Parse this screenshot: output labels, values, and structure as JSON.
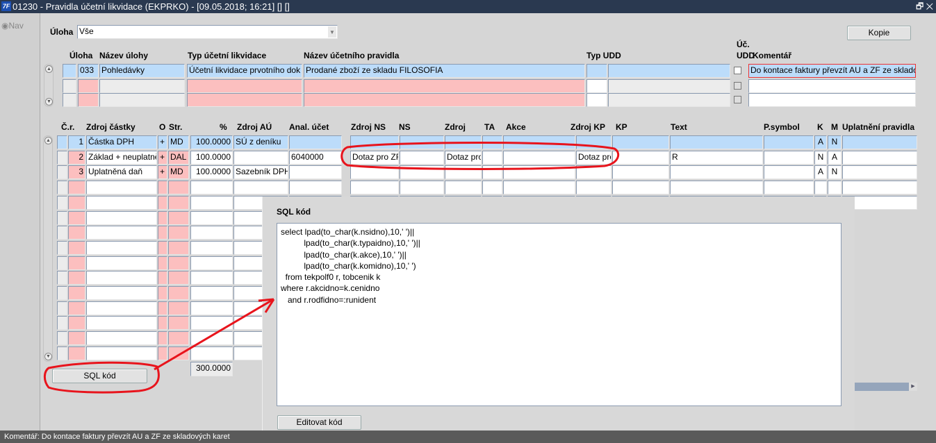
{
  "window": {
    "title": "01230 - Pravidla účetní likvidace (EKPRKO) - [09.05.2018; 16:21] [] []",
    "app_icon": "7F",
    "restore_icon": "🗗",
    "close_icon": "✕"
  },
  "nav": {
    "label": "Nav"
  },
  "filter": {
    "label": "Úloha",
    "value": "Vše"
  },
  "buttons": {
    "kopie": "Kopie",
    "sql": "SQL kód",
    "edit": "Editovat kód"
  },
  "top_grid": {
    "headers": [
      "Úloha",
      "Název úlohy",
      "Typ účetní likvidace",
      "Název účetního pravidla",
      "Typ UDD",
      "Úč.",
      "UDD",
      "Komentář"
    ],
    "rows": [
      {
        "uloha": "033",
        "nazev": "Pohledávky",
        "typ": "Účetní likvidace prvotního dok",
        "pravidlo": "Prodané zboží ze skladu FILOSOFIA",
        "komentar": "Do kontace faktury převzít AU a ZF ze skladových karet"
      },
      {
        "uloha": "",
        "nazev": "",
        "typ": "",
        "pravidlo": "",
        "komentar": ""
      },
      {
        "uloha": "",
        "nazev": "",
        "typ": "",
        "pravidlo": "",
        "komentar": ""
      }
    ]
  },
  "bottom_grid": {
    "headers": [
      "Č.r.",
      "Zdroj částky",
      "O",
      "Str.",
      "%",
      "Zdroj AÚ",
      "Anal. účet",
      "Zdroj NS",
      "NS",
      "Zdroj",
      "TA",
      "Akce",
      "Zdroj KP",
      "KP",
      "Text",
      "P.symbol",
      "K",
      "M",
      "Uplatnění pravidla"
    ],
    "rows": [
      [
        "1",
        "Částka DPH",
        "+",
        "MD",
        "100.0000",
        "SÚ z deníku",
        "",
        "",
        "",
        "",
        "",
        "",
        "",
        "",
        "",
        "",
        "A",
        "N",
        ""
      ],
      [
        "2",
        "Základ + neuplatněná daň",
        "+",
        "DAL",
        "100.0000",
        "",
        "6040000",
        "Dotaz pro ZF",
        "",
        "Dotaz pro",
        "",
        "",
        "Dotaz pro",
        "",
        "R",
        "",
        "N",
        "A",
        ""
      ],
      [
        "3",
        "Uplatněná daň",
        "+",
        "MD",
        "100.0000",
        "Sazebník DPH",
        "",
        "",
        "",
        "",
        "",
        "",
        "",
        "",
        "",
        "",
        "A",
        "N",
        ""
      ]
    ],
    "total_percent": "300.0000"
  },
  "sql_dialog": {
    "title": "SQL kód",
    "code": "select lpad(to_char(k.nsidno),10,' ')||\n          lpad(to_char(k.typaidno),10,' ')||\n          lpad(to_char(k.akce),10,' ')||\n          lpad(to_char(k.komidno),10,' ')\n  from tekpolf0 r, tobcenik k\nwhere r.akcidno=k.cenidno\n   and r.rodfidno=:runident"
  },
  "status": {
    "text": "Komentář: Do kontace faktury převzít AU a ZF ze skladových karet"
  },
  "colors": {
    "selected": "#bcdcfa",
    "required": "#fcbfbf",
    "annotation": "#e8141c",
    "titlebar": "#2a3950"
  }
}
